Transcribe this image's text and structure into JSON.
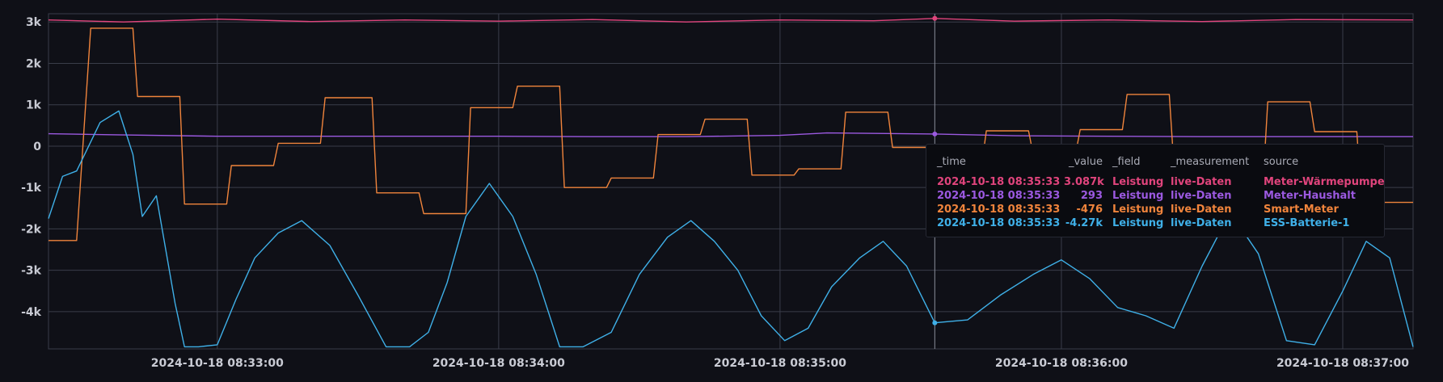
{
  "chart_data": {
    "type": "line",
    "x_ticks": [
      "2024-10-18 08:33:00",
      "2024-10-18 08:34:00",
      "2024-10-18 08:35:00",
      "2024-10-18 08:36:00",
      "2024-10-18 08:37:00"
    ],
    "y_ticks": [
      "3k",
      "2k",
      "1k",
      "0",
      "-1k",
      "-2k",
      "-3k",
      "-4k"
    ],
    "y_tick_values": [
      3000,
      2000,
      1000,
      0,
      -1000,
      -2000,
      -3000,
      -4000
    ],
    "ylim": [
      -4900,
      3200
    ],
    "xlim": [
      "2024-10-18 08:32:24",
      "2024-10-18 08:37:15"
    ],
    "grid": true,
    "hover_time": "2024-10-18 08:35:33",
    "series": [
      {
        "name": "Meter-Wärmepumpe",
        "color": "#e0447c",
        "x": [
          "08:32:24",
          "08:32:40",
          "08:33:00",
          "08:33:20",
          "08:33:40",
          "08:34:00",
          "08:34:20",
          "08:34:40",
          "08:35:00",
          "08:35:20",
          "08:35:33",
          "08:35:50",
          "08:36:10",
          "08:36:30",
          "08:36:50",
          "08:37:15"
        ],
        "values": [
          3050,
          3000,
          3070,
          3010,
          3050,
          3020,
          3060,
          3000,
          3050,
          3030,
          3087,
          3020,
          3050,
          3010,
          3060,
          3050
        ]
      },
      {
        "name": "Meter-Haushalt",
        "color": "#9b59e0",
        "x": [
          "08:32:24",
          "08:32:40",
          "08:33:00",
          "08:33:30",
          "08:34:00",
          "08:34:20",
          "08:34:40",
          "08:35:00",
          "08:35:10",
          "08:35:33",
          "08:35:50",
          "08:36:10",
          "08:36:30",
          "08:36:50",
          "08:37:15"
        ],
        "values": [
          300,
          270,
          240,
          240,
          240,
          230,
          230,
          260,
          320,
          293,
          250,
          240,
          230,
          230,
          230
        ]
      },
      {
        "name": "Smart-Meter",
        "color": "#f0843c",
        "x": [
          "08:32:24",
          "08:32:30",
          "08:32:33",
          "08:32:42",
          "08:32:43",
          "08:32:52",
          "08:32:53",
          "08:33:02",
          "08:33:03",
          "08:33:12",
          "08:33:13",
          "08:33:22",
          "08:33:23",
          "08:33:33",
          "08:33:34",
          "08:33:43",
          "08:33:44",
          "08:33:53",
          "08:33:54",
          "08:34:03",
          "08:34:04",
          "08:34:13",
          "08:34:14",
          "08:34:23",
          "08:34:24",
          "08:34:33",
          "08:34:34",
          "08:34:43",
          "08:34:44",
          "08:34:53",
          "08:34:54",
          "08:35:03",
          "08:35:04",
          "08:35:13",
          "08:35:14",
          "08:35:23",
          "08:35:24",
          "08:35:33",
          "08:35:34",
          "08:35:43",
          "08:35:44",
          "08:35:53",
          "08:35:54",
          "08:36:03",
          "08:36:04",
          "08:36:13",
          "08:36:14",
          "08:36:23",
          "08:36:24",
          "08:36:33",
          "08:36:34",
          "08:36:43",
          "08:36:44",
          "08:36:53",
          "08:36:54",
          "08:37:03",
          "08:37:04",
          "08:37:15"
        ],
        "values": [
          -2280,
          -2280,
          2850,
          2850,
          1200,
          1200,
          -1400,
          -1400,
          -470,
          -470,
          70,
          70,
          1170,
          1170,
          -1130,
          -1130,
          -1630,
          -1630,
          930,
          930,
          1450,
          1450,
          -1000,
          -1000,
          -770,
          -770,
          280,
          280,
          650,
          650,
          -700,
          -700,
          -550,
          -550,
          820,
          820,
          -30,
          -30,
          -476,
          -476,
          370,
          370,
          -200,
          -200,
          400,
          400,
          1250,
          1250,
          -500,
          -500,
          -900,
          -900,
          1070,
          1070,
          350,
          350,
          -1360,
          -1360
        ]
      },
      {
        "name": "ESS-Batterie-1",
        "color": "#3fb0e8",
        "x": [
          "08:32:24",
          "08:32:27",
          "08:32:30",
          "08:32:35",
          "08:32:39",
          "08:32:42",
          "08:32:44",
          "08:32:47",
          "08:32:49",
          "08:32:51",
          "08:32:53",
          "08:32:56",
          "08:33:00",
          "08:33:04",
          "08:33:08",
          "08:33:13",
          "08:33:18",
          "08:33:24",
          "08:33:30",
          "08:33:36",
          "08:33:41",
          "08:33:45",
          "08:33:49",
          "08:33:53",
          "08:33:58",
          "08:34:03",
          "08:34:08",
          "08:34:13",
          "08:34:18",
          "08:34:24",
          "08:34:30",
          "08:34:36",
          "08:34:41",
          "08:34:46",
          "08:34:51",
          "08:34:56",
          "08:35:01",
          "08:35:06",
          "08:35:11",
          "08:35:17",
          "08:35:22",
          "08:35:27",
          "08:35:33",
          "08:35:40",
          "08:35:47",
          "08:35:54",
          "08:36:00",
          "08:36:06",
          "08:36:12",
          "08:36:18",
          "08:36:24",
          "08:36:30",
          "08:36:36",
          "08:36:42",
          "08:36:48",
          "08:36:54",
          "08:37:00",
          "08:37:05",
          "08:37:10",
          "08:37:15"
        ],
        "values": [
          -1750,
          -730,
          -600,
          570,
          850,
          -200,
          -1700,
          -1200,
          -2500,
          -3800,
          -4850,
          -4850,
          -4800,
          -3700,
          -2700,
          -2100,
          -1800,
          -2400,
          -3600,
          -4850,
          -4850,
          -4500,
          -3300,
          -1700,
          -900,
          -1700,
          -3100,
          -4850,
          -4850,
          -4500,
          -3100,
          -2200,
          -1800,
          -2300,
          -3000,
          -4100,
          -4700,
          -4400,
          -3400,
          -2700,
          -2300,
          -2900,
          -4270,
          -4200,
          -3600,
          -3100,
          -2750,
          -3200,
          -3900,
          -4100,
          -4400,
          -2900,
          -1600,
          -2600,
          -4700,
          -4800,
          -3500,
          -2300,
          -2700,
          -4850
        ]
      }
    ]
  },
  "tooltip": {
    "headers": [
      "_time",
      "_value",
      "_field",
      "_measurement",
      "source"
    ],
    "rows": [
      {
        "time": "2024-10-18 08:35:33",
        "value": "3.087k",
        "field": "Leistung",
        "measurement": "live-Daten",
        "source": "Meter-Wärmepumpe",
        "color": "#e0447c"
      },
      {
        "time": "2024-10-18 08:35:33",
        "value": "293",
        "field": "Leistung",
        "measurement": "live-Daten",
        "source": "Meter-Haushalt",
        "color": "#9b59e0"
      },
      {
        "time": "2024-10-18 08:35:33",
        "value": "-476",
        "field": "Leistung",
        "measurement": "live-Daten",
        "source": "Smart-Meter",
        "color": "#f0843c"
      },
      {
        "time": "2024-10-18 08:35:33",
        "value": "-4.27k",
        "field": "Leistung",
        "measurement": "live-Daten",
        "source": "ESS-Batterie-1",
        "color": "#3fb0e8"
      }
    ]
  }
}
